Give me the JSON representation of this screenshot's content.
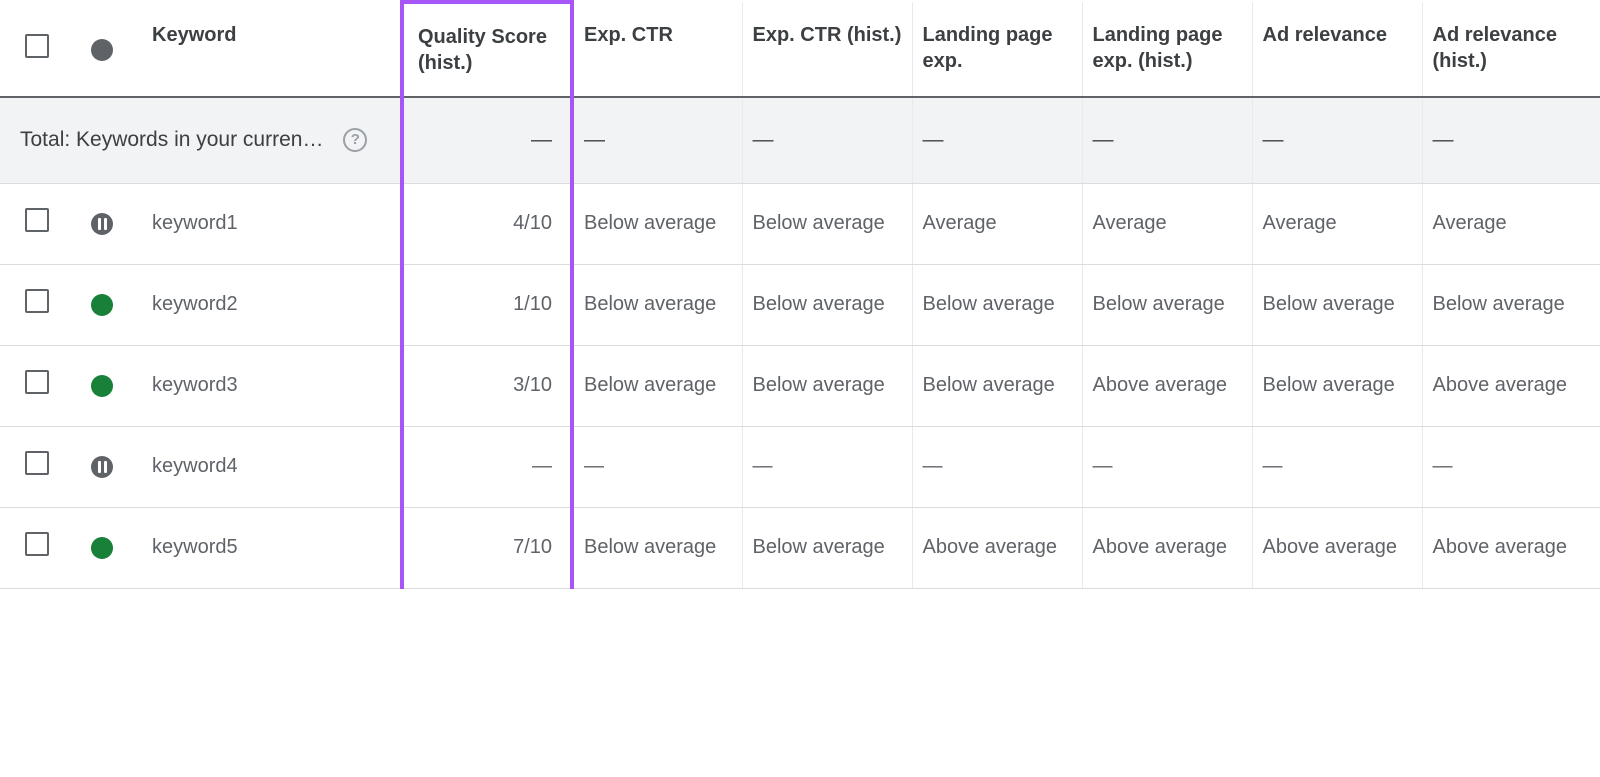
{
  "colors": {
    "highlight": "#a855f7",
    "row_border": "#dadce0",
    "header_border": "#5f6368"
  },
  "header": {
    "keyword": "Keyword",
    "qs_hist": "Quality Score (hist.)",
    "exp_ctr": "Exp. CTR",
    "exp_ctr_hist": "Exp. CTR (hist.)",
    "lp_exp": "Landing page exp.",
    "lp_exp_hist": "Landing page exp. (hist.)",
    "ad_rel": "Ad relevance",
    "ad_rel_hist": "Ad relevance (hist.)"
  },
  "summary": {
    "label": "Total: Keywords in your curren…",
    "help_glyph": "?",
    "qs": "—",
    "exp_ctr": "—",
    "exp_ctr_hist": "—",
    "lp_exp": "—",
    "lp_exp_hist": "—",
    "ad_rel": "—",
    "ad_rel_hist": "—"
  },
  "rows": [
    {
      "status": "paused",
      "keyword": "keyword1",
      "qs": "4/10",
      "exp_ctr": "Below average",
      "exp_ctr_hist": "Below average",
      "lp_exp": "Average",
      "lp_exp_hist": "Average",
      "ad_rel": "Average",
      "ad_rel_hist": "Average"
    },
    {
      "status": "enabled",
      "keyword": "keyword2",
      "qs": "1/10",
      "exp_ctr": "Below average",
      "exp_ctr_hist": "Below average",
      "lp_exp": "Below average",
      "lp_exp_hist": "Below average",
      "ad_rel": "Below average",
      "ad_rel_hist": "Below average"
    },
    {
      "status": "enabled",
      "keyword": "keyword3",
      "qs": "3/10",
      "exp_ctr": "Below average",
      "exp_ctr_hist": "Below average",
      "lp_exp": "Below average",
      "lp_exp_hist": "Above average",
      "ad_rel": "Below average",
      "ad_rel_hist": "Above average"
    },
    {
      "status": "paused",
      "keyword": "keyword4",
      "qs": "—",
      "exp_ctr": "—",
      "exp_ctr_hist": "—",
      "lp_exp": "—",
      "lp_exp_hist": "—",
      "ad_rel": "—",
      "ad_rel_hist": "—"
    },
    {
      "status": "enabled",
      "keyword": "keyword5",
      "qs": "7/10",
      "exp_ctr": "Below average",
      "exp_ctr_hist": "Below average",
      "lp_exp": "Above average",
      "lp_exp_hist": "Above average",
      "ad_rel": "Above average",
      "ad_rel_hist": "Above average"
    }
  ]
}
